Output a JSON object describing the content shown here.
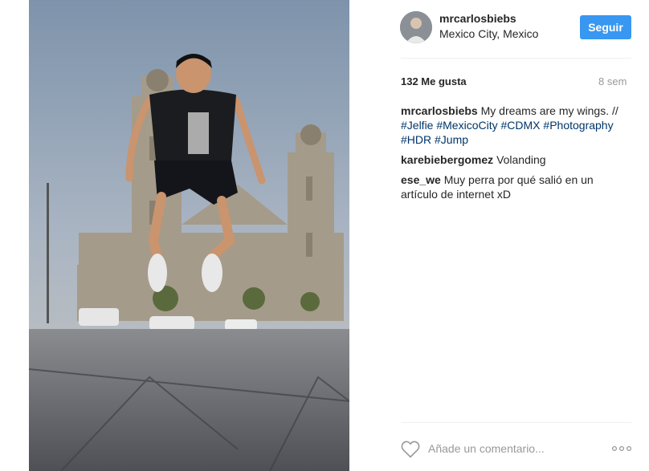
{
  "post": {
    "username": "mrcarlosbiebs",
    "location": "Mexico City, Mexico",
    "follow_label": "Seguir",
    "likes": "132 Me gusta",
    "time": "8 sem",
    "caption_user": "mrcarlosbiebs",
    "caption_text": "My dreams are my wings. //",
    "hashtags": [
      "#Jelfie",
      "#MexicoCity",
      "#CDMX",
      "#Photography",
      "#HDR",
      "#Jump"
    ]
  },
  "comments": [
    {
      "user": "karebiebergomez",
      "text": "Volanding"
    },
    {
      "user": "ese_we",
      "text": "Muy perra por qué salió en un artículo de internet xD"
    }
  ],
  "add_comment": {
    "placeholder": "Añade un comentario..."
  },
  "icons": {
    "like": "heart-outline-icon",
    "more": "more-options-icon"
  },
  "colors": {
    "follow_button": "#3897f0",
    "hashtag": "#003569",
    "secondary_text": "#999999"
  }
}
